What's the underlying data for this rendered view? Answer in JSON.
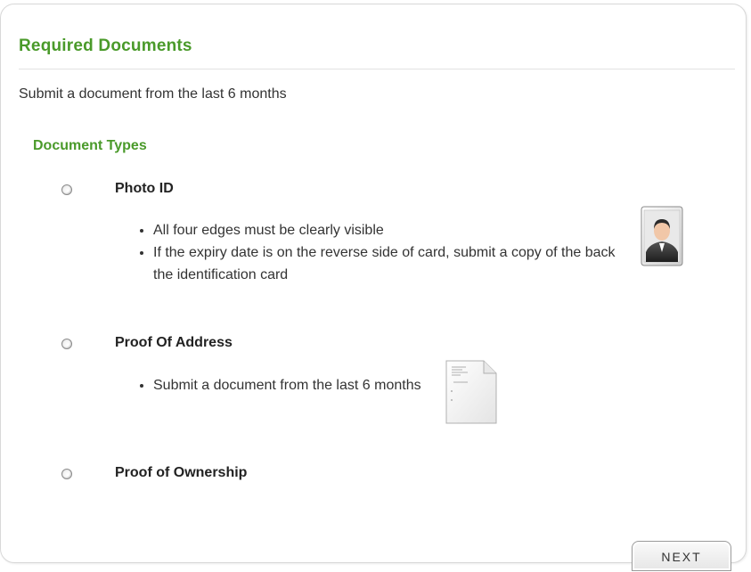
{
  "header": {
    "title": "Required Documents",
    "subtitle": "Submit a document from the last 6 months"
  },
  "section": {
    "title": "Document Types"
  },
  "options": [
    {
      "label": "Photo ID",
      "selected": false,
      "bullets": [
        "All four edges must be clearly visible",
        "If the expiry date is on the reverse side of card, submit a copy of the back the identification card"
      ],
      "icon": "person-photo-icon"
    },
    {
      "label": "Proof Of Address",
      "selected": false,
      "bullets": [
        "Submit a document from the last 6 months"
      ],
      "icon": "document-icon"
    },
    {
      "label": "Proof of Ownership",
      "selected": false,
      "bullets": []
    }
  ],
  "footer": {
    "next_label": "NEXT"
  },
  "colors": {
    "accent_green": "#4a9a2a",
    "text": "#333333",
    "border": "#d8d8d8"
  }
}
